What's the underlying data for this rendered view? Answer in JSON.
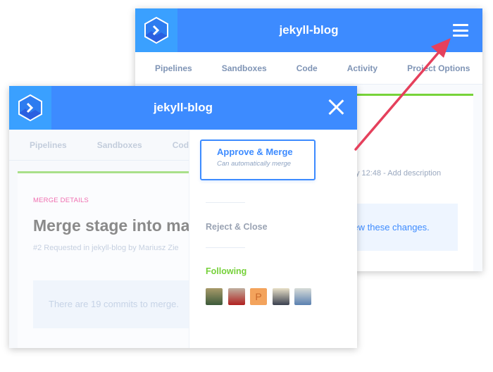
{
  "back_window": {
    "title": "jekyll-blog",
    "nav": [
      "Pipelines",
      "Sandboxes",
      "Code",
      "Activity",
      "Project Options"
    ],
    "description": "y 12:48 - Add description",
    "review_text": "view these changes."
  },
  "front_window": {
    "title": "jekyll-blog",
    "nav": [
      "Pipelines",
      "Sandboxes",
      "Code"
    ],
    "merge_details_label": "MERGE DETAILS",
    "merge_title": "Merge stage into mas",
    "merge_subtitle": "#2 Requested in jekyll-blog by Mariusz Zie",
    "commits_text": "There are 19 commits to merge.",
    "drawer": {
      "approve_label": "Approve & Merge",
      "approve_sub": "Can automatically merge",
      "reject_label": "Reject & Close",
      "following_label": "Following",
      "avatars": [
        {
          "type": "photo"
        },
        {
          "type": "photo"
        },
        {
          "type": "initial",
          "letter": "P"
        },
        {
          "type": "photo"
        },
        {
          "type": "photo"
        }
      ]
    }
  },
  "colors": {
    "brand": "#3d8bff",
    "success": "#76d13a",
    "accent_pink": "#f06fb0",
    "arrow": "#e5405c"
  }
}
